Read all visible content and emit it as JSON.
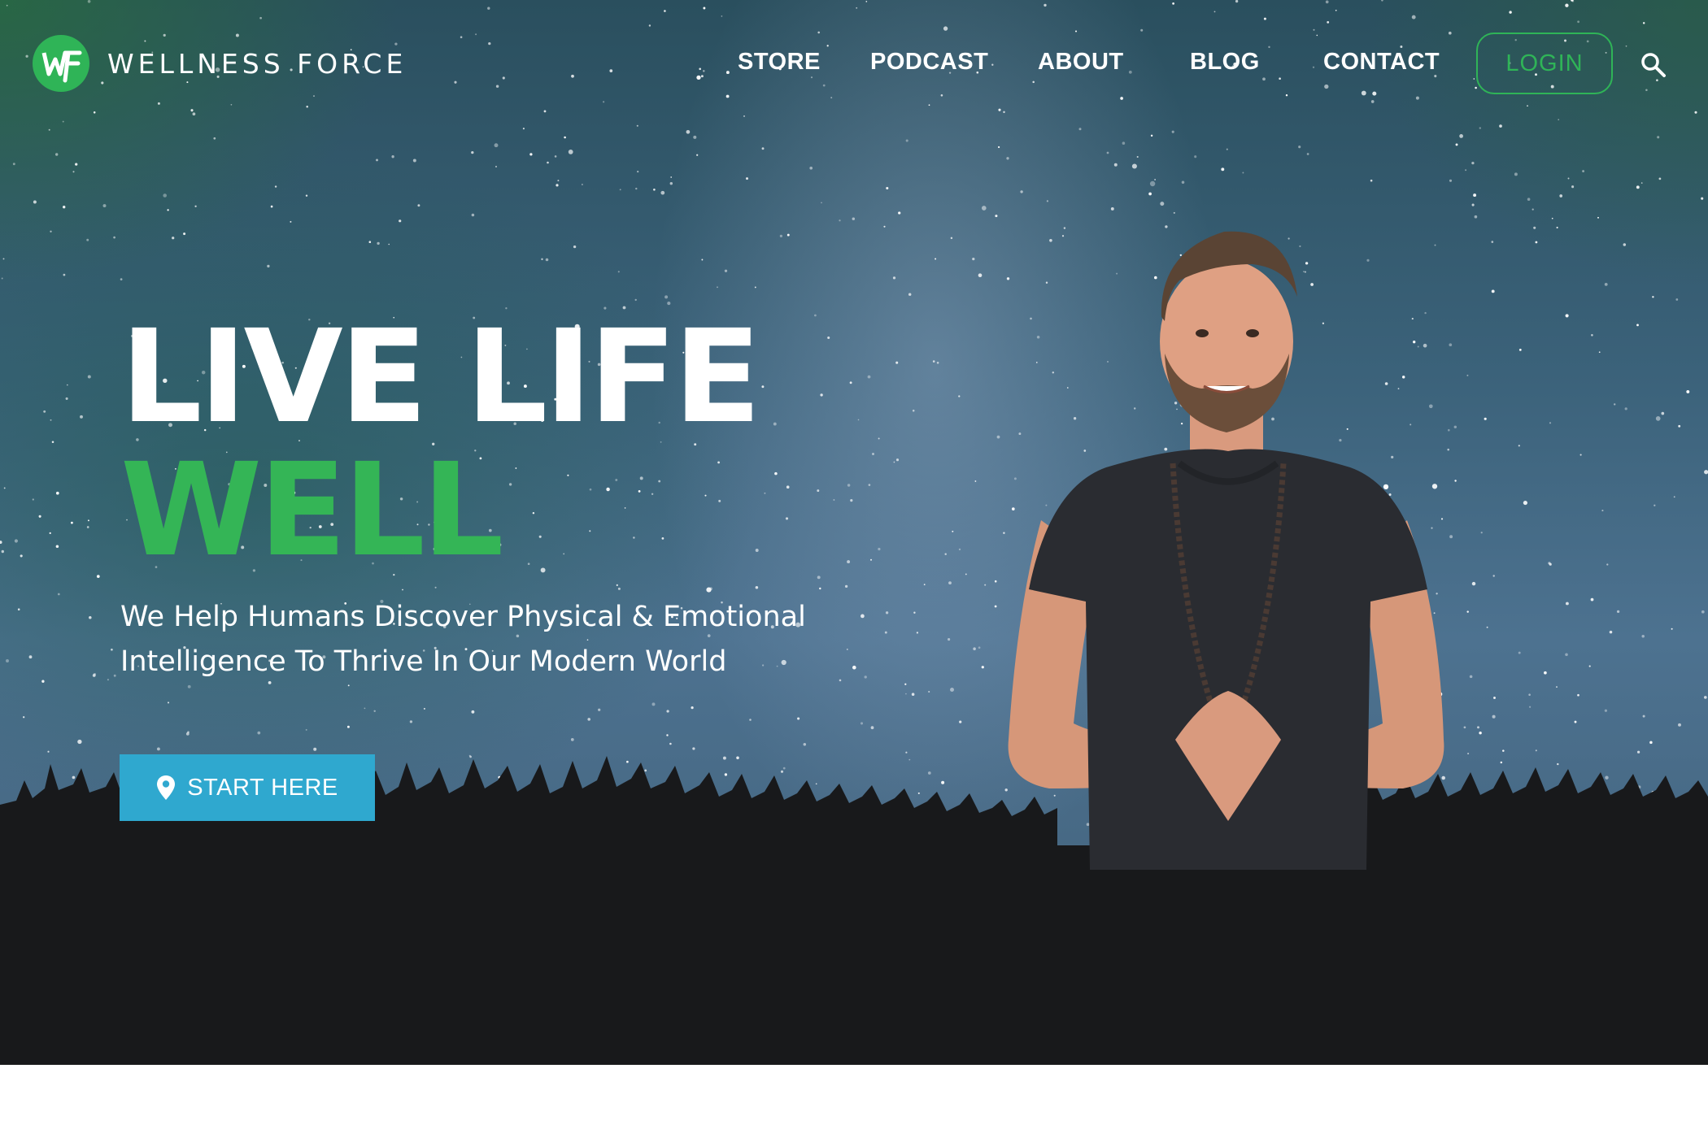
{
  "brand": {
    "name": "WELLNESS FORCE",
    "logo_mark_text": "WF",
    "accent_color": "#34b556",
    "cta_color": "#2fa8cf"
  },
  "nav": {
    "items": [
      {
        "label": "STORE"
      },
      {
        "label": "PODCAST"
      },
      {
        "label": "ABOUT"
      },
      {
        "label": "BLOG"
      },
      {
        "label": "CONTACT"
      }
    ],
    "login_label": "LOGIN",
    "search_icon": "search-icon"
  },
  "hero": {
    "headline_line1": "LIVE LIFE",
    "headline_line2": "WELL",
    "tagline_line1": "We Help Humans Discover Physical & Emotional",
    "tagline_line2": "Intelligence To Thrive In Our Modern World",
    "cta_label": "START HERE",
    "cta_icon": "map-pin-icon"
  }
}
